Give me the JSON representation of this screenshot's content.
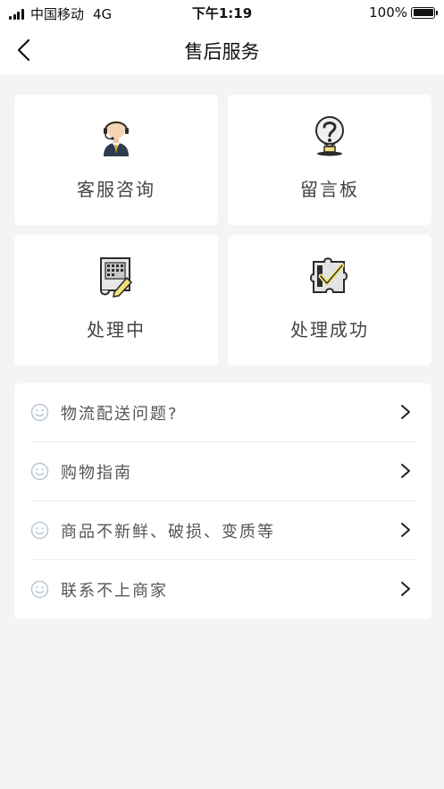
{
  "status_bar": {
    "carrier": "中国移动",
    "network": "4G",
    "time": "下午1:19",
    "battery": "100%",
    "battery_level": 1.0
  },
  "nav": {
    "title": "售后服务",
    "back_icon": "chevron-left-icon"
  },
  "cards": [
    {
      "label": "客服咨询",
      "icon": "customer-service-icon"
    },
    {
      "label": "留言板",
      "icon": "question-bubble-icon"
    },
    {
      "label": "处理中",
      "icon": "processing-document-icon"
    },
    {
      "label": "处理成功",
      "icon": "success-puzzle-icon"
    }
  ],
  "faq": [
    {
      "label": "物流配送问题?",
      "icon": "smile-icon"
    },
    {
      "label": "购物指南",
      "icon": "smile-icon"
    },
    {
      "label": "商品不新鲜、破损、变质等",
      "icon": "smile-icon"
    },
    {
      "label": "联系不上商家",
      "icon": "smile-icon"
    }
  ],
  "colors": {
    "background": "#f4f4f4",
    "card": "#ffffff",
    "accent_yellow": "#f3e27a",
    "icon_dark": "#2b2b2b",
    "smile": "#b9c6d3"
  }
}
